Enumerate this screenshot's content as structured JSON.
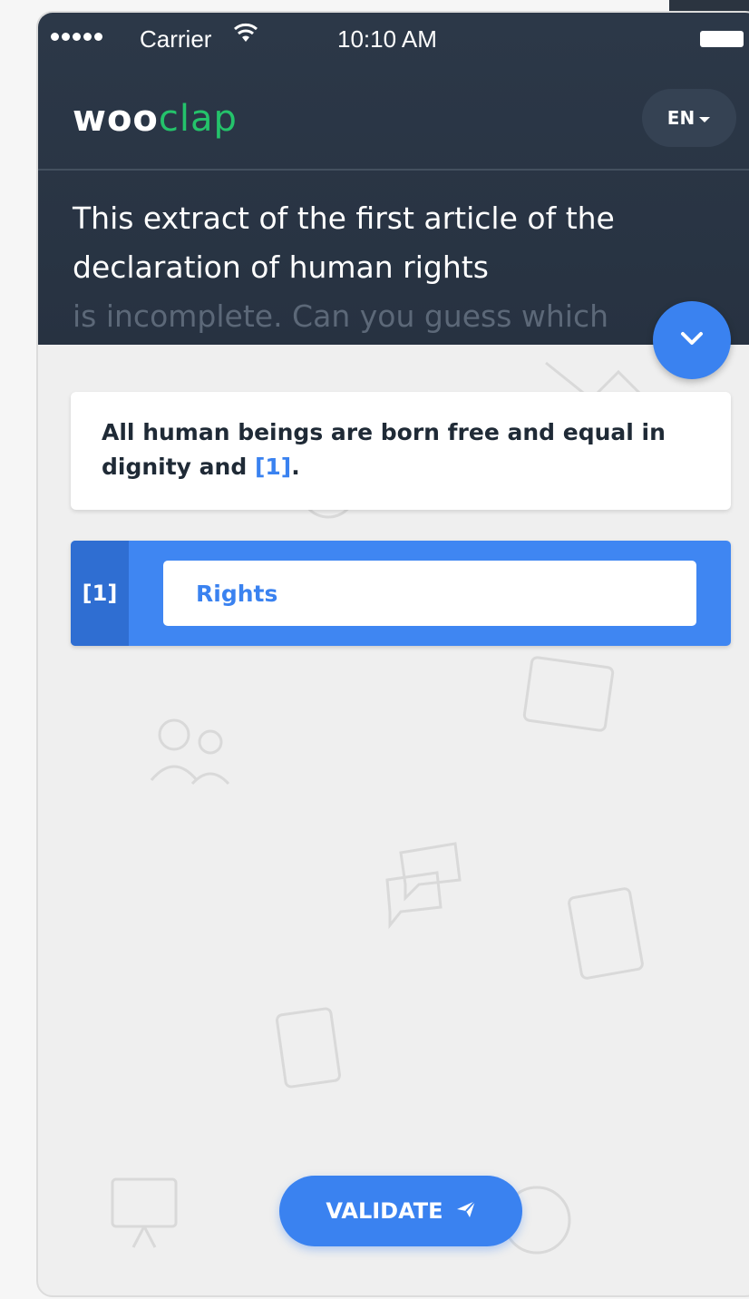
{
  "status_bar": {
    "carrier": "Carrier",
    "time": "10:10 AM"
  },
  "app": {
    "logo_bold": "woo",
    "logo_light": "clap",
    "language": "EN",
    "brand_color": "#24c36b",
    "accent_color": "#3a82f0"
  },
  "question": {
    "line_visible": "This extract of the first article of the declaration of human rights",
    "line_faded": "is incomplete. Can you guess which"
  },
  "sentence": {
    "text_before": "All human beings are born free and equal in dignity and",
    "blank_label": "[1]",
    "text_after": "."
  },
  "answers": [
    {
      "index_label": "[1]",
      "value": "Rights"
    }
  ],
  "actions": {
    "validate_label": "VALIDATE"
  },
  "icons": [
    "wifi-icon",
    "battery-icon",
    "chevron-down-icon",
    "caret-down-icon",
    "send-icon"
  ]
}
